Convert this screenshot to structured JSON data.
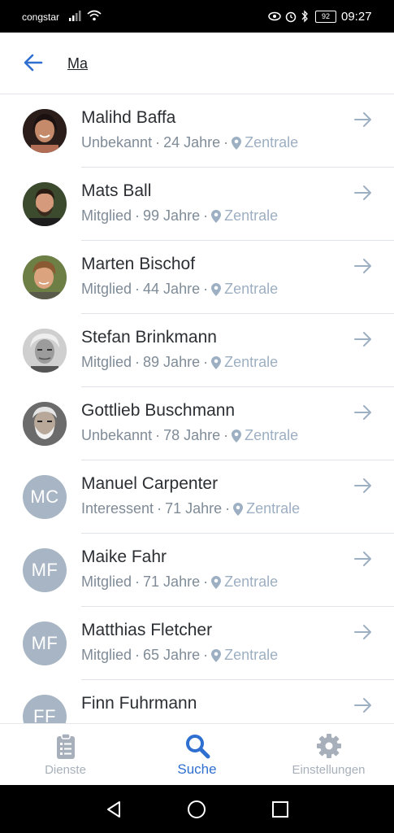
{
  "status_bar": {
    "carrier": "congstar",
    "battery": "92",
    "time": "09:27"
  },
  "search": {
    "query": "Ma"
  },
  "results": [
    {
      "name": "Malihd Baffa",
      "status": "Unbekannt",
      "age": "24 Jahre",
      "location": "Zentrale",
      "avatar": {
        "type": "photo",
        "icon": "person-photo-1"
      }
    },
    {
      "name": "Mats Ball",
      "status": "Mitglied",
      "age": "99 Jahre",
      "location": "Zentrale",
      "avatar": {
        "type": "photo",
        "icon": "person-photo-2"
      }
    },
    {
      "name": "Marten Bischof",
      "status": "Mitglied",
      "age": "44 Jahre",
      "location": "Zentrale",
      "avatar": {
        "type": "photo",
        "icon": "person-photo-3"
      }
    },
    {
      "name": "Stefan Brinkmann",
      "status": "Mitglied",
      "age": "89 Jahre",
      "location": "Zentrale",
      "avatar": {
        "type": "photo",
        "icon": "person-photo-4"
      }
    },
    {
      "name": "Gottlieb Buschmann",
      "status": "Unbekannt",
      "age": "78 Jahre",
      "location": "Zentrale",
      "avatar": {
        "type": "photo",
        "icon": "person-photo-5"
      }
    },
    {
      "name": "Manuel Carpenter",
      "status": "Interessent",
      "age": "71 Jahre",
      "location": "Zentrale",
      "avatar": {
        "type": "initials",
        "initials": "MC"
      }
    },
    {
      "name": "Maike Fahr",
      "status": "Mitglied",
      "age": "71 Jahre",
      "location": "Zentrale",
      "avatar": {
        "type": "initials",
        "initials": "MF"
      }
    },
    {
      "name": "Matthias Fletcher",
      "status": "Mitglied",
      "age": "65 Jahre",
      "location": "Zentrale",
      "avatar": {
        "type": "initials",
        "initials": "MF"
      }
    },
    {
      "name": "Finn Fuhrmann",
      "status": "",
      "age": "",
      "location": "",
      "avatar": {
        "type": "initials",
        "initials": "FF"
      }
    }
  ],
  "bottom_nav": {
    "items": [
      {
        "label": "Dienste",
        "icon": "clipboard-icon",
        "active": false
      },
      {
        "label": "Suche",
        "icon": "search-icon",
        "active": true
      },
      {
        "label": "Einstellungen",
        "icon": "gear-icon",
        "active": false
      }
    ]
  },
  "colors": {
    "accent": "#2f6fd0",
    "avatar_bg": "#a8b5c4",
    "muted": "#7f8b97",
    "location": "#9dafc2"
  }
}
